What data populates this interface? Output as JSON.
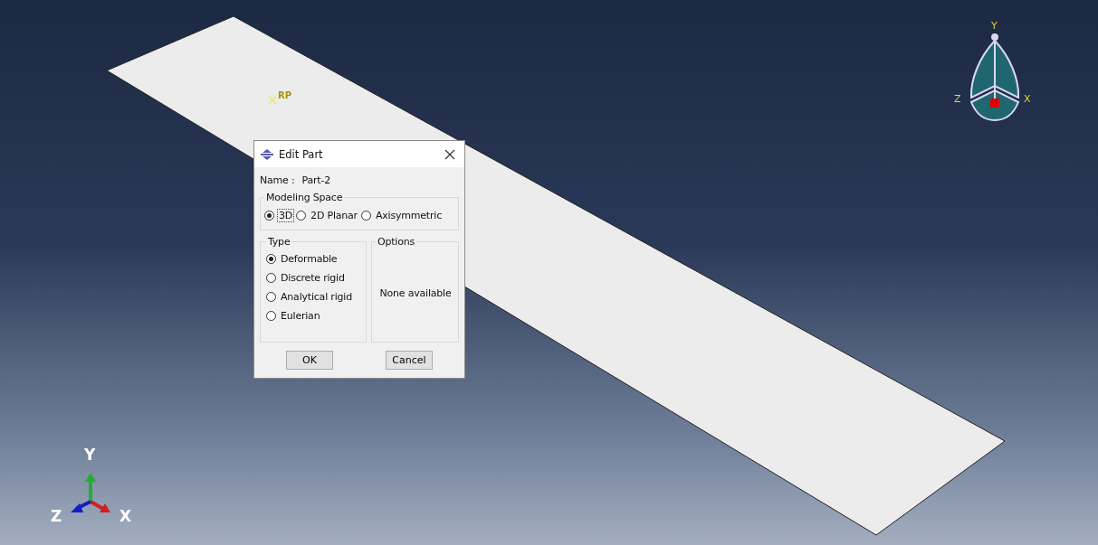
{
  "viewport": {
    "reference_point": {
      "label": "RP"
    },
    "view_triad": {
      "y": "Y",
      "z": "Z",
      "x": "X"
    },
    "axis_triad": {
      "y": "Y",
      "z": "Z",
      "x": "X"
    }
  },
  "dialog": {
    "title": "Edit Part",
    "name_label": "Name :",
    "name_value": "Part-2",
    "modeling_space": {
      "title": "Modeling Space",
      "options": [
        {
          "label": "3D",
          "selected": true,
          "focused": true
        },
        {
          "label": "2D Planar",
          "selected": false,
          "focused": false
        },
        {
          "label": "Axisymmetric",
          "selected": false,
          "focused": false
        }
      ]
    },
    "type": {
      "title": "Type",
      "options": [
        {
          "label": "Deformable",
          "selected": true
        },
        {
          "label": "Discrete rigid",
          "selected": false
        },
        {
          "label": "Analytical rigid",
          "selected": false
        },
        {
          "label": "Eulerian",
          "selected": false
        }
      ]
    },
    "options": {
      "title": "Options",
      "message": "None available"
    },
    "buttons": [
      "OK",
      "Cancel"
    ]
  }
}
